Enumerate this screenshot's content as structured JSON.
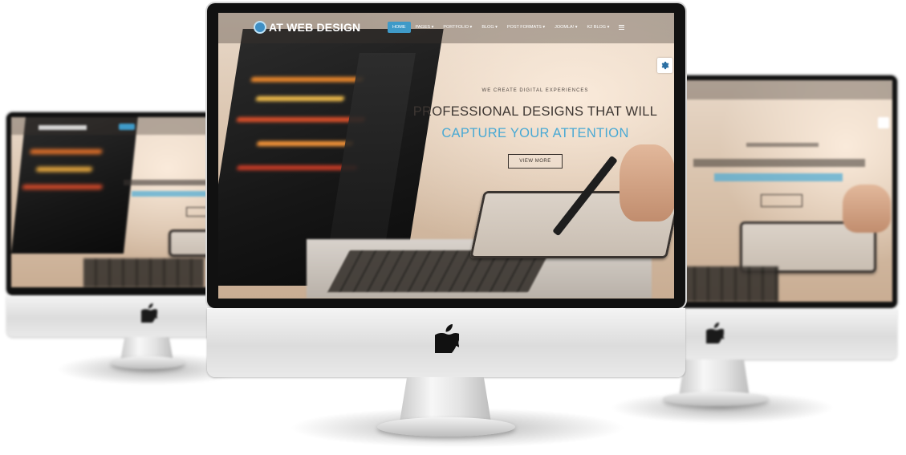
{
  "site": {
    "logo_text": "AT WEB DESIGN",
    "nav": [
      {
        "label": "HOME",
        "active": true
      },
      {
        "label": "PAGES ▾",
        "active": false
      },
      {
        "label": "PORTFOLIO ▾",
        "active": false
      },
      {
        "label": "BLOG ▾",
        "active": false
      },
      {
        "label": "POST FORMATS ▾",
        "active": false
      },
      {
        "label": "JOOMLA! ▾",
        "active": false
      },
      {
        "label": "K2 BLOG ▾",
        "active": false
      }
    ],
    "hero": {
      "eyebrow": "WE CREATE DIGITAL EXPERIENCES",
      "line1": "PROFESSIONAL DESIGNS THAT WILL",
      "line2": "CAPTURE YOUR ATTENTION",
      "button": "VIEW MORE"
    }
  },
  "colors": {
    "accent": "#3f9ac8",
    "headline": "#3d3632",
    "highlight": "#49a9d4",
    "bezel": "#111111",
    "chin": "#e6e6e6"
  },
  "icons": [
    "apple-logo-icon",
    "gear-icon",
    "hamburger-menu-icon",
    "logo-mark-icon"
  ]
}
